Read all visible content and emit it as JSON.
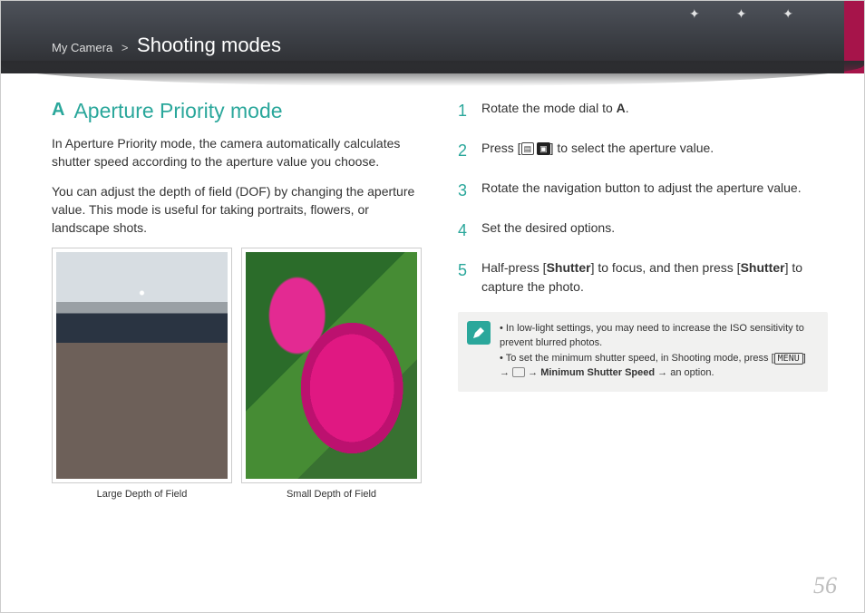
{
  "header": {
    "breadcrumb_root": "My Camera",
    "breadcrumb_sep": ">",
    "title": "Shooting modes"
  },
  "left": {
    "mode_icon": "A",
    "heading": "Aperture Priority mode",
    "p1": "In Aperture Priority mode, the camera automatically calculates shutter speed according to the aperture value you choose.",
    "p2": "You can adjust the depth of field (DOF) by changing the aperture value. This mode is useful for taking portraits, flowers, or landscape shots.",
    "caption1": "Large Depth of Field",
    "caption2": "Small Depth of Field"
  },
  "steps": {
    "n1": "1",
    "t1a": "Rotate the mode dial to ",
    "t1_icon": "A",
    "t1b": ".",
    "n2": "2",
    "t2a": "Press [",
    "t2b": "] to select the aperture value.",
    "n3": "3",
    "t3": "Rotate the navigation button to adjust the aperture value.",
    "n4": "4",
    "t4": "Set the desired options.",
    "n5": "5",
    "t5a": "Half-press [",
    "t5b": "Shutter",
    "t5c": "] to focus, and then press [",
    "t5d": "Shutter",
    "t5e": "] to capture the photo."
  },
  "note": {
    "li1": "In low-light settings, you may need to increase the ISO sensitivity to prevent blurred photos.",
    "li2a": "To set the minimum shutter speed, in Shooting mode, press [",
    "li2_menu": "MENU",
    "li2b": "] → ",
    "li2c": " → ",
    "li2_bold": "Minimum Shutter Speed",
    "li2d": " → an option."
  },
  "page_number": "56"
}
